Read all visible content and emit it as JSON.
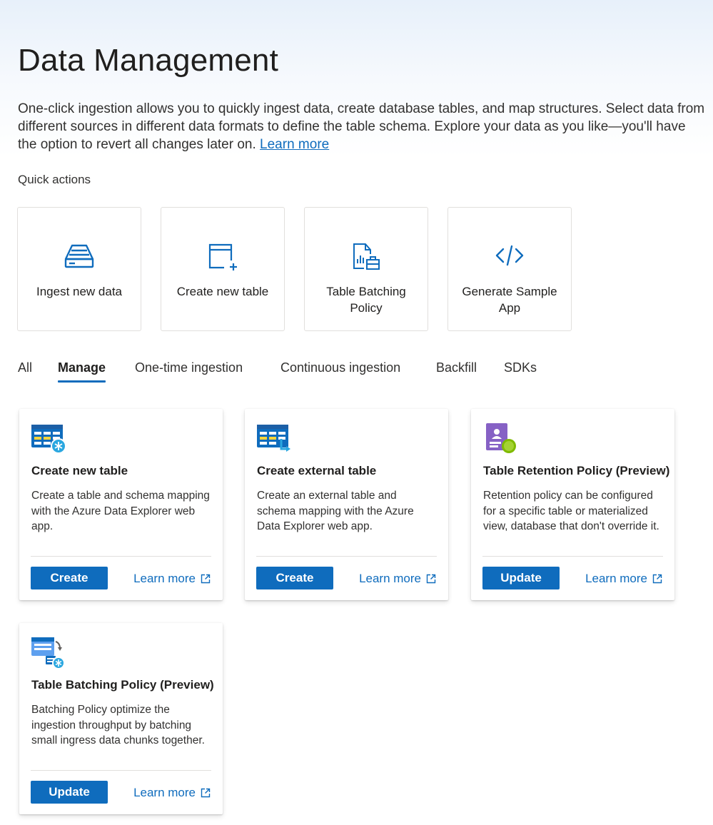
{
  "header": {
    "title": "Data Management",
    "intro": "One-click ingestion allows you to quickly ingest data, create database tables, and map structures. Select data from different sources in different data formats to define the table schema. Explore your data as you like—you'll have the option to revert all changes later on.",
    "intro_link": "Learn more"
  },
  "quick_actions": {
    "label": "Quick actions",
    "items": [
      {
        "label": "Ingest new data",
        "icon": "tray-stack-icon"
      },
      {
        "label": "Create new table",
        "icon": "table-add-icon"
      },
      {
        "label": "Table Batching Policy",
        "icon": "document-chart-icon"
      },
      {
        "label": "Generate Sample App",
        "icon": "code-icon"
      }
    ]
  },
  "tabs": {
    "items": [
      "All",
      "Manage",
      "One-time ingestion",
      "Continuous ingestion",
      "Backfill",
      "SDKs"
    ],
    "active": "Manage"
  },
  "cards": [
    {
      "title": "Create new table",
      "description": "Create a table and schema mapping with the Azure Data Explorer web app.",
      "button": "Create",
      "link": "Learn more",
      "icon": "table-create-icon"
    },
    {
      "title": "Create external table",
      "description": "Create an external table and schema mapping with the Azure Data Explorer web app.",
      "button": "Create",
      "link": "Learn more",
      "icon": "external-table-icon"
    },
    {
      "title": "Table Retention Policy (Preview)",
      "description": "Retention policy can be configured for a specific table or materialized view, database that don't override it.",
      "button": "Update",
      "link": "Learn more",
      "icon": "retention-certificate-icon"
    },
    {
      "title": "Table Batching Policy (Preview)",
      "description": "Batching Policy optimize the ingestion throughput by batching small ingress data chunks together.",
      "button": "Update",
      "link": "Learn more",
      "icon": "batching-policy-icon"
    }
  ],
  "colors": {
    "accent": "#0f6cbd",
    "text": "#201f1e",
    "border": "#e1dfdd"
  }
}
